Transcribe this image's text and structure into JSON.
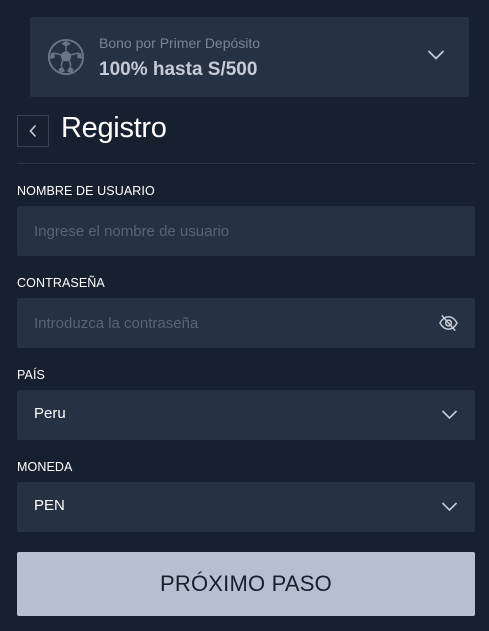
{
  "bonus": {
    "subtitle": "Bono por Primer Depósito",
    "title": "100% hasta S/500",
    "icon": "soccer-ball-icon"
  },
  "header": {
    "back_icon": "chevron-left-icon",
    "title": "Registro"
  },
  "form": {
    "username": {
      "label": "NOMBRE DE USUARIO",
      "placeholder": "Ingrese el nombre de usuario",
      "value": ""
    },
    "password": {
      "label": "CONTRASEÑA",
      "placeholder": "Introduzca la contraseña",
      "value": "",
      "toggle_icon": "eye-slash-icon"
    },
    "country": {
      "label": "PAÍS",
      "value": "Peru"
    },
    "currency": {
      "label": "MONEDA",
      "value": "PEN"
    },
    "submit_label": "PRÓXIMO PASO"
  },
  "colors": {
    "background": "#17202e",
    "field": "#263142",
    "button": "#b5bfcd",
    "text": "#ffffff",
    "placeholder": "#586477"
  }
}
